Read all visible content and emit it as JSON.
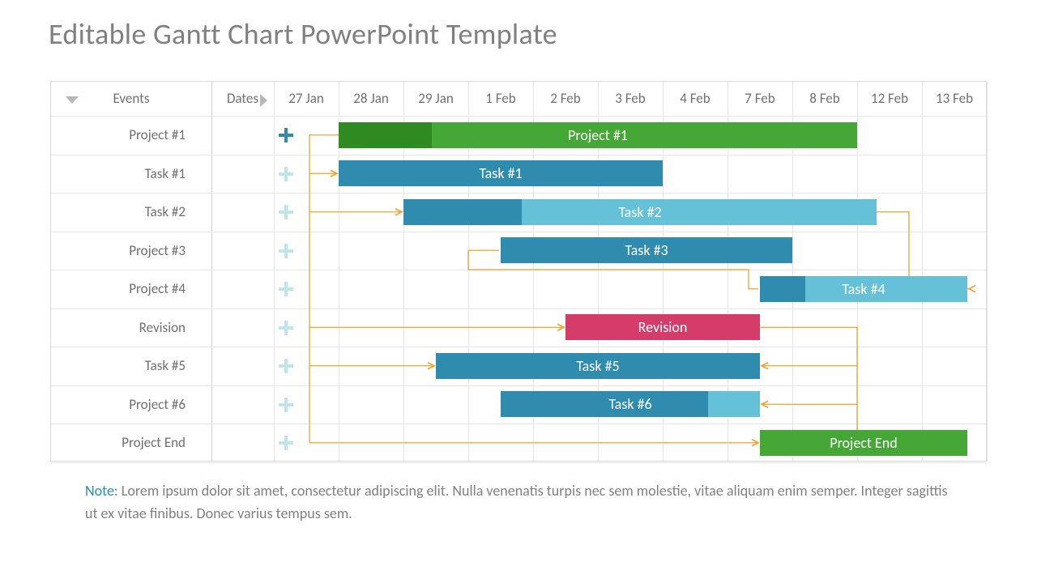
{
  "title": "Editable Gantt Chart PowerPoint Template",
  "note_label": "Note:",
  "note_text": " Lorem ipsum dolor sit amet, consectetur adipiscing elit. Nulla venenatis turpis nec sem molestie, vitae aliquam enim semper. Integer sagittis ut ex vitae finibus. Donec varius tempus sem.",
  "headers": {
    "events": "Events",
    "dates": "Dates"
  },
  "dates": [
    "27 Jan",
    "28 Jan",
    "29 Jan",
    "1 Feb",
    "2 Feb",
    "3 Feb",
    "4 Feb",
    "7 Feb",
    "8 Feb",
    "12 Feb",
    "13 Feb"
  ],
  "rows": [
    {
      "label": "Project #1",
      "plus_active": true
    },
    {
      "label": "Task #1",
      "plus_active": false
    },
    {
      "label": "Task #2",
      "plus_active": false
    },
    {
      "label": "Project #3",
      "plus_active": false
    },
    {
      "label": "Project #4",
      "plus_active": false
    },
    {
      "label": "Revision",
      "plus_active": false
    },
    {
      "label": "Task #5",
      "plus_active": false
    },
    {
      "label": "Project #6",
      "plus_active": false
    },
    {
      "label": "Project End",
      "plus_active": false
    }
  ],
  "bars": [
    {
      "row": 0,
      "label": "Project #1",
      "start": 1.0,
      "end": 9.0,
      "fill": "#45a735",
      "prog_fill": "#2f8a21",
      "prog": 0.18
    },
    {
      "row": 1,
      "label": "Task #1",
      "start": 1.0,
      "end": 6.0,
      "fill": "#2f8cae",
      "prog_fill": "#2f8cae",
      "prog": 0
    },
    {
      "row": 2,
      "label": "Task #2",
      "start": 2.0,
      "end": 9.3,
      "fill": "#64c1d8",
      "prog_fill": "#2f8cae",
      "prog": 0.25
    },
    {
      "row": 3,
      "label": "Task #3",
      "start": 3.5,
      "end": 8.0,
      "fill": "#2f8cae",
      "prog_fill": "#2f8cae",
      "prog": 0
    },
    {
      "row": 4,
      "label": "Task #4",
      "start": 7.5,
      "end": 10.7,
      "fill": "#64c1d8",
      "prog_fill": "#2f8cae",
      "prog": 0.22
    },
    {
      "row": 5,
      "label": "Revision",
      "start": 4.5,
      "end": 7.5,
      "fill": "#d63c69",
      "prog_fill": "#d63c69",
      "prog": 0
    },
    {
      "row": 6,
      "label": "Task #5",
      "start": 2.5,
      "end": 7.5,
      "fill": "#2f8cae",
      "prog_fill": "#2f8cae",
      "prog": 0
    },
    {
      "row": 7,
      "label": "Task #6",
      "start": 3.5,
      "end": 7.5,
      "fill": "#64c1d8",
      "prog_fill": "#2f8cae",
      "prog": 0.8
    },
    {
      "row": 8,
      "label": "Project End",
      "start": 7.5,
      "end": 10.7,
      "fill": "#45a735",
      "prog_fill": "#45a735",
      "prog": 0
    }
  ],
  "colors": {
    "connector": "#f0a030",
    "plus_active": "#2f8cae",
    "plus_inactive": "#bfe4ea"
  },
  "chart_data": {
    "type": "bar",
    "title": "Editable Gantt Chart PowerPoint Template",
    "xlabel": "Dates",
    "ylabel": "Events",
    "categories": [
      "27 Jan",
      "28 Jan",
      "29 Jan",
      "1 Feb",
      "2 Feb",
      "3 Feb",
      "4 Feb",
      "7 Feb",
      "8 Feb",
      "12 Feb",
      "13 Feb"
    ],
    "series": [
      {
        "name": "Project #1",
        "start": "28 Jan",
        "end": "8 Feb",
        "progress": 0.18,
        "color": "#45a735"
      },
      {
        "name": "Task #1",
        "start": "28 Jan",
        "end": "3 Feb",
        "progress": 0,
        "color": "#2f8cae"
      },
      {
        "name": "Task #2",
        "start": "29 Jan",
        "end": "12 Feb",
        "progress": 0.25,
        "color": "#64c1d8"
      },
      {
        "name": "Task #3",
        "start": "1 Feb",
        "end": "7 Feb",
        "progress": 0,
        "color": "#2f8cae"
      },
      {
        "name": "Task #4",
        "start": "7 Feb",
        "end": "13 Feb",
        "progress": 0.22,
        "color": "#64c1d8"
      },
      {
        "name": "Revision",
        "start": "2 Feb",
        "end": "7 Feb",
        "progress": 0,
        "color": "#d63c69"
      },
      {
        "name": "Task #5",
        "start": "29 Jan",
        "end": "7 Feb",
        "progress": 0,
        "color": "#2f8cae"
      },
      {
        "name": "Task #6",
        "start": "1 Feb",
        "end": "7 Feb",
        "progress": 0.8,
        "color": "#64c1d8"
      },
      {
        "name": "Project End",
        "start": "7 Feb",
        "end": "13 Feb",
        "progress": 0,
        "color": "#45a735"
      }
    ],
    "dependencies": [
      [
        "Project #1",
        "Task #1"
      ],
      [
        "Project #1",
        "Task #2"
      ],
      [
        "Project #1",
        "Revision"
      ],
      [
        "Project #1",
        "Task #5"
      ],
      [
        "Project #1",
        "Project End"
      ],
      [
        "Task #2",
        "Task #4"
      ],
      [
        "Task #3",
        "Task #4"
      ],
      [
        "Revision",
        "Task #6"
      ],
      [
        "Revision",
        "Task #5"
      ],
      [
        "Revision",
        "Project End"
      ]
    ]
  }
}
